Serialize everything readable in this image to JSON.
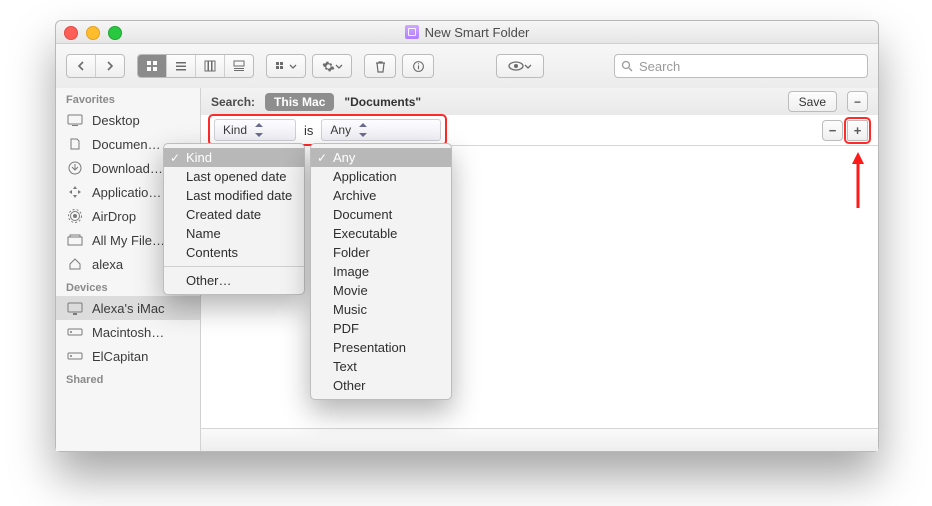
{
  "window": {
    "title": "New Smart Folder"
  },
  "sidebar": {
    "sections": [
      {
        "header": "Favorites",
        "items": [
          {
            "label": "Desktop",
            "icon": "desktop-icon"
          },
          {
            "label": "Documen…",
            "icon": "folder-icon"
          },
          {
            "label": "Download…",
            "icon": "download-icon"
          },
          {
            "label": "Applicatio…",
            "icon": "apps-icon"
          },
          {
            "label": "AirDrop",
            "icon": "airdrop-icon"
          },
          {
            "label": "All My File…",
            "icon": "allfiles-icon"
          },
          {
            "label": "alexa",
            "icon": "home-icon"
          }
        ]
      },
      {
        "header": "Devices",
        "items": [
          {
            "label": "Alexa's iMac",
            "icon": "imac-icon",
            "selected": true
          },
          {
            "label": "Macintosh…",
            "icon": "disk-icon"
          },
          {
            "label": "ElCapitan",
            "icon": "disk-icon"
          }
        ]
      },
      {
        "header": "Shared",
        "items": []
      }
    ]
  },
  "toolbar": {
    "search_placeholder": "Search"
  },
  "scope": {
    "label": "Search:",
    "primary": "This Mac",
    "secondary": "\"Documents\"",
    "save": "Save"
  },
  "criteria": {
    "attribute": "Kind",
    "operator": "is",
    "value": "Any"
  },
  "menus": {
    "attribute": {
      "selected": "Kind",
      "items": [
        "Kind",
        "Last opened date",
        "Last modified date",
        "Created date",
        "Name",
        "Contents"
      ],
      "footer": "Other…"
    },
    "value": {
      "selected": "Any",
      "items": [
        "Any",
        "Application",
        "Archive",
        "Document",
        "Executable",
        "Folder",
        "Image",
        "Movie",
        "Music",
        "PDF",
        "Presentation",
        "Text",
        "Other"
      ]
    }
  }
}
